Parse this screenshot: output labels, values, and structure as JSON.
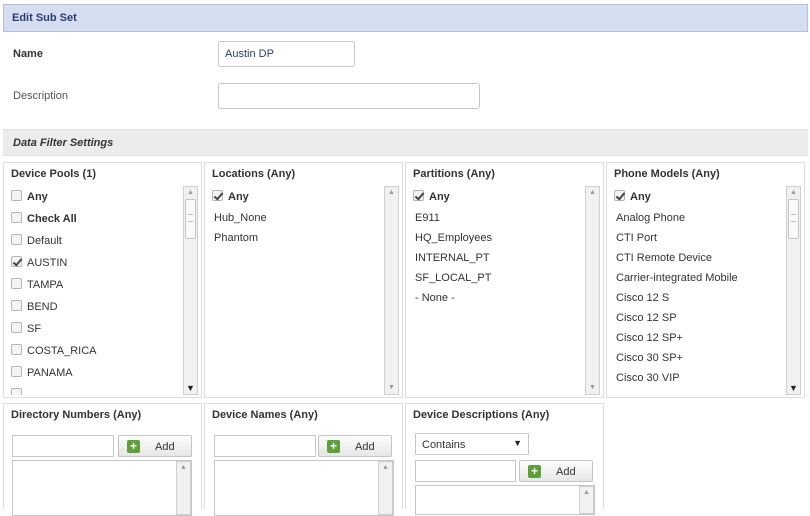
{
  "header": {
    "title": "Edit Sub Set"
  },
  "form": {
    "name_label": "Name",
    "name_value": "Austin DP",
    "description_label": "Description",
    "description_value": ""
  },
  "section": {
    "title": "Data Filter Settings"
  },
  "panels": {
    "device_pools": {
      "title": "Device Pools (1)",
      "items": [
        {
          "label": "Any",
          "checked": false,
          "bold": true
        },
        {
          "label": "Check All",
          "checked": false,
          "bold": true
        },
        {
          "label": "Default",
          "checked": false,
          "bold": false
        },
        {
          "label": "AUSTIN",
          "checked": true,
          "bold": false
        },
        {
          "label": "TAMPA",
          "checked": false,
          "bold": false
        },
        {
          "label": "BEND",
          "checked": false,
          "bold": false
        },
        {
          "label": "SF",
          "checked": false,
          "bold": false
        },
        {
          "label": "COSTA_RICA",
          "checked": false,
          "bold": false
        },
        {
          "label": "PANAMA",
          "checked": false,
          "bold": false
        }
      ]
    },
    "locations": {
      "title": "Locations (Any)",
      "any_label": "Any",
      "items": [
        "Hub_None",
        "Phantom"
      ]
    },
    "partitions": {
      "title": "Partitions (Any)",
      "any_label": "Any",
      "items": [
        "E911",
        "HQ_Employees",
        "INTERNAL_PT",
        "SF_LOCAL_PT",
        "- None -"
      ]
    },
    "phone_models": {
      "title": "Phone Models (Any)",
      "any_label": "Any",
      "items": [
        "Analog Phone",
        "CTI Port",
        "CTI Remote Device",
        "Carrier-integrated Mobile",
        "Cisco 12 S",
        "Cisco 12 SP",
        "Cisco 12 SP+",
        "Cisco 30 SP+",
        "Cisco 30 VIP"
      ]
    },
    "directory_numbers": {
      "title": "Directory Numbers (Any)",
      "input_value": "",
      "add_label": "Add"
    },
    "device_names": {
      "title": "Device Names (Any)",
      "input_value": "",
      "add_label": "Add"
    },
    "device_descriptions": {
      "title": "Device Descriptions (Any)",
      "match_mode": "Contains",
      "input_value": "",
      "add_label": "Add"
    }
  }
}
